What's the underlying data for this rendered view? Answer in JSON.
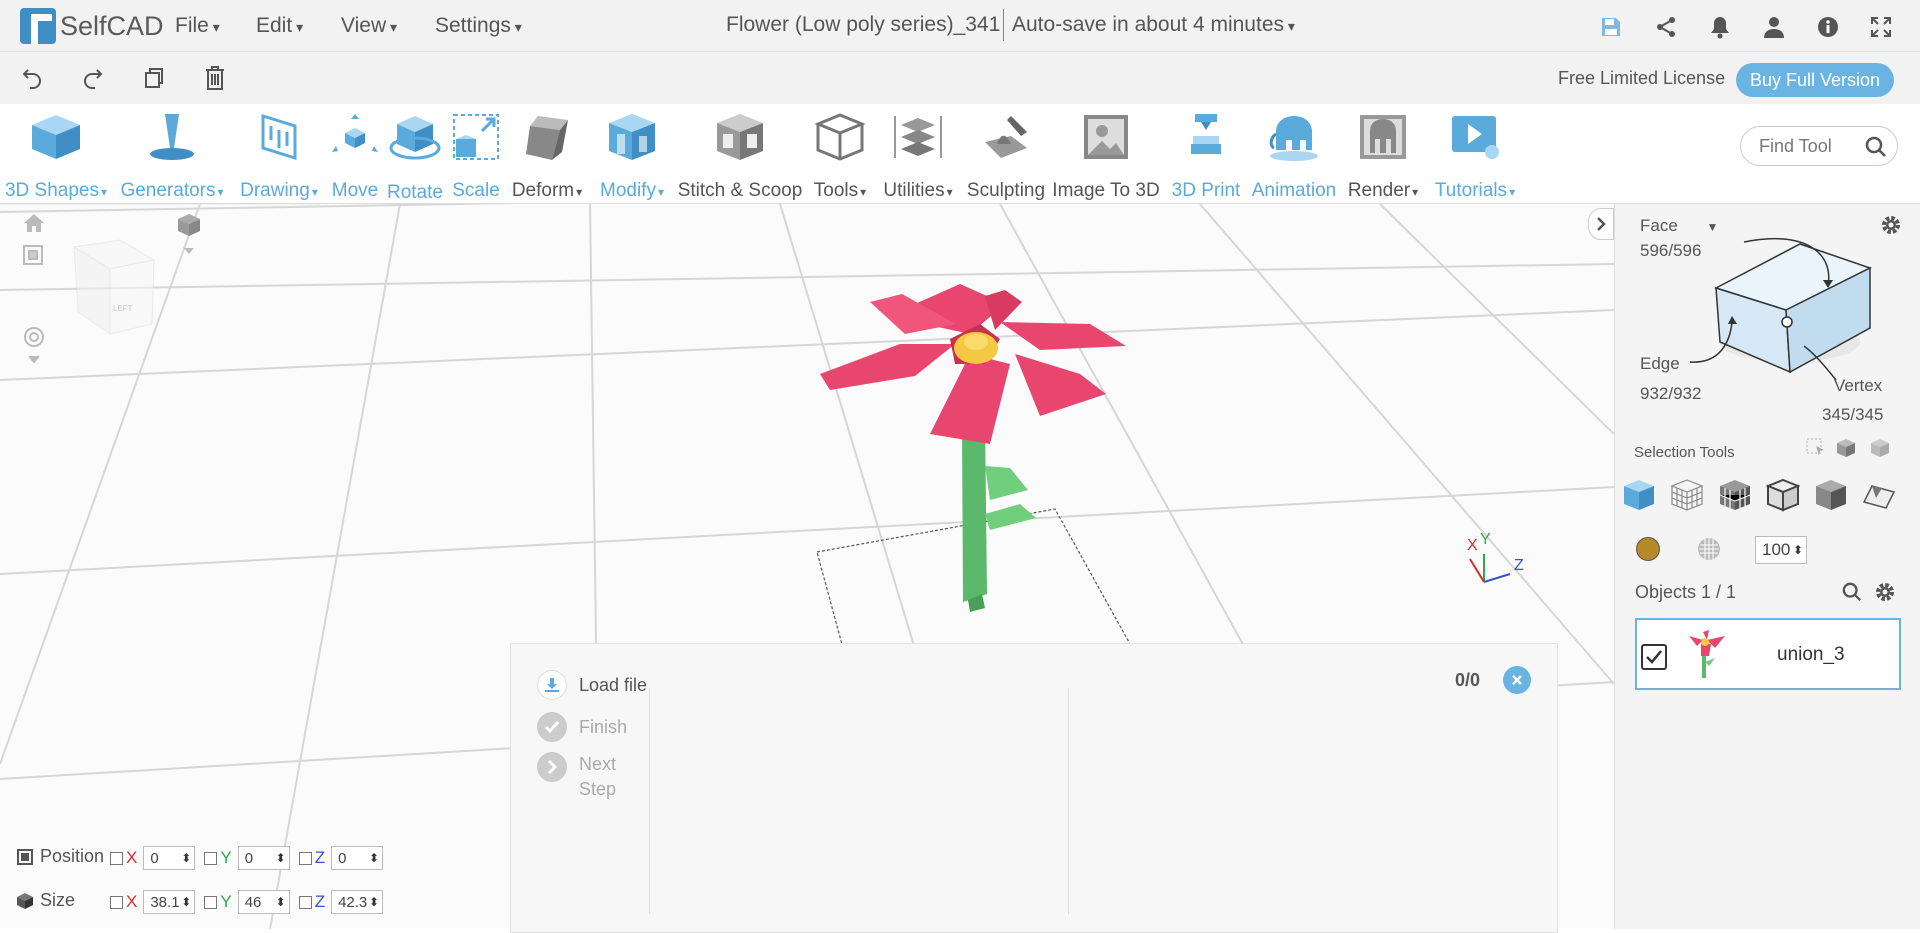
{
  "app": {
    "name": "SelfCAD"
  },
  "menu": {
    "file": "File",
    "edit": "Edit",
    "view": "View",
    "settings": "Settings"
  },
  "document": {
    "title": "Flower (Low poly series)_341",
    "autosave": "Auto-save in about 4 minutes"
  },
  "top_icons": [
    "save-icon",
    "share-icon",
    "bell-icon",
    "user-icon",
    "info-icon",
    "fullscreen-icon"
  ],
  "license": {
    "label": "Free Limited License",
    "buy": "Buy Full Version"
  },
  "ribbon": {
    "shapes": "3D Shapes",
    "generators": "Generators",
    "drawing": "Drawing",
    "move": "Move",
    "rotate": "Rotate",
    "scale": "Scale",
    "deform": "Deform",
    "modify": "Modify",
    "stitch": "Stitch & Scoop",
    "tools": "Tools",
    "utilities": "Utilities",
    "sculpting": "Sculpting",
    "image3d": "Image To 3D",
    "print3d": "3D Print",
    "animation": "Animation",
    "render": "Render",
    "tutorials": "Tutorials",
    "find_tool": "Find Tool"
  },
  "selection": {
    "mode": "Face",
    "face_count": "596/596",
    "edge_label": "Edge",
    "edge_count": "932/932",
    "vertex_label": "Vertex",
    "vertex_count": "345/345",
    "tools_label": "Selection Tools",
    "opacity": "100"
  },
  "objects": {
    "header": "Objects 1 / 1",
    "items": [
      {
        "name": "union_3",
        "checked": true
      }
    ]
  },
  "load_panel": {
    "load_file": "Load file",
    "finish": "Finish",
    "next": "Next",
    "step": "Step",
    "counter": "0/0"
  },
  "transform": {
    "position_label": "Position",
    "size_label": "Size",
    "position": {
      "x": "0",
      "y": "0",
      "z": "0"
    },
    "size": {
      "x": "38.1",
      "y": "46",
      "z": "42.3"
    },
    "axis": {
      "x": "X",
      "y": "Y",
      "z": "Z"
    }
  },
  "viewcube": {
    "face": "LEFT"
  },
  "colors": {
    "accent": "#5aaadc",
    "petal": "#e8466e",
    "stem": "#5cb86a",
    "center": "#f4c842",
    "swatch": "#b8892a"
  }
}
